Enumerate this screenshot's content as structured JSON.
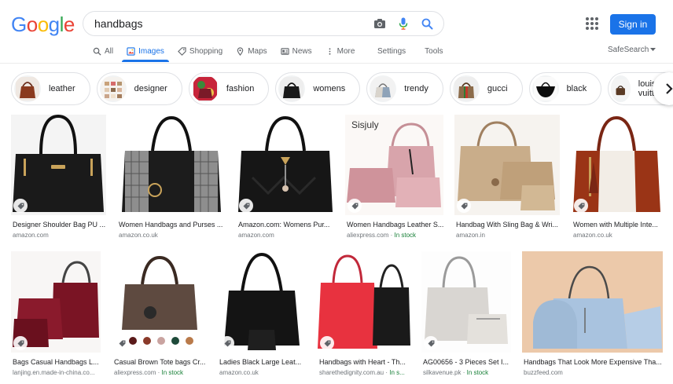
{
  "logo": {
    "letters": [
      "G",
      "o",
      "o",
      "g",
      "l",
      "e"
    ],
    "colors": [
      "#4285f4",
      "#ea4335",
      "#fbbc05",
      "#4285f4",
      "#34a853",
      "#ea4335"
    ]
  },
  "search": {
    "value": "handbags"
  },
  "header": {
    "signin": "Sign in"
  },
  "tabs": [
    {
      "label": "All",
      "icon": "search-icon"
    },
    {
      "label": "Images",
      "icon": "image-icon",
      "active": true
    },
    {
      "label": "Shopping",
      "icon": "tag-icon"
    },
    {
      "label": "Maps",
      "icon": "pin-icon"
    },
    {
      "label": "News",
      "icon": "news-icon"
    },
    {
      "label": "More",
      "icon": "more-icon"
    }
  ],
  "tools": {
    "settings": "Settings",
    "tools": "Tools",
    "safesearch": "SafeSearch"
  },
  "chips": [
    "leather",
    "designer",
    "fashion",
    "womens",
    "trendy",
    "gucci",
    "black",
    "louis vuitton"
  ],
  "results_row1": [
    {
      "title": "Designer Shoulder Bag PU ...",
      "source": "amazon.com",
      "stock": ""
    },
    {
      "title": "Women Handbags and Purses ...",
      "source": "amazon.co.uk",
      "stock": ""
    },
    {
      "title": "Amazon.com: Womens Pur...",
      "source": "amazon.com",
      "stock": ""
    },
    {
      "title": "Women Handbags Leather S...",
      "source": "aliexpress.com",
      "stock": "In stock",
      "watermark": "Sisjuly"
    },
    {
      "title": "Handbag With Sling Bag & Wri...",
      "source": "amazon.in",
      "stock": ""
    },
    {
      "title": "Women with Multiple Inte...",
      "source": "amazon.co.uk",
      "stock": ""
    }
  ],
  "results_row2": [
    {
      "title": "Bags Casual Handbags L...",
      "source": "lanjing.en.made-in-china.co...",
      "stock": ""
    },
    {
      "title": "Casual Brown Tote bags Cr...",
      "source": "aliexpress.com",
      "stock": "In stock"
    },
    {
      "title": "Ladies Black Large Leat...",
      "source": "amazon.co.uk",
      "stock": ""
    },
    {
      "title": "Handbags with Heart - Th...",
      "source": "sharethedignity.com.au",
      "stock": "In s..."
    },
    {
      "title": "AG00656 - 3 Pieces Set I...",
      "source": "silkavenue.pk",
      "stock": "In stock"
    },
    {
      "title": "Handbags That Look More Expensive Tha...",
      "source": "buzzfeed.com",
      "stock": ""
    }
  ],
  "colors": {
    "accent": "#1a73e8",
    "stock": "#188038"
  }
}
